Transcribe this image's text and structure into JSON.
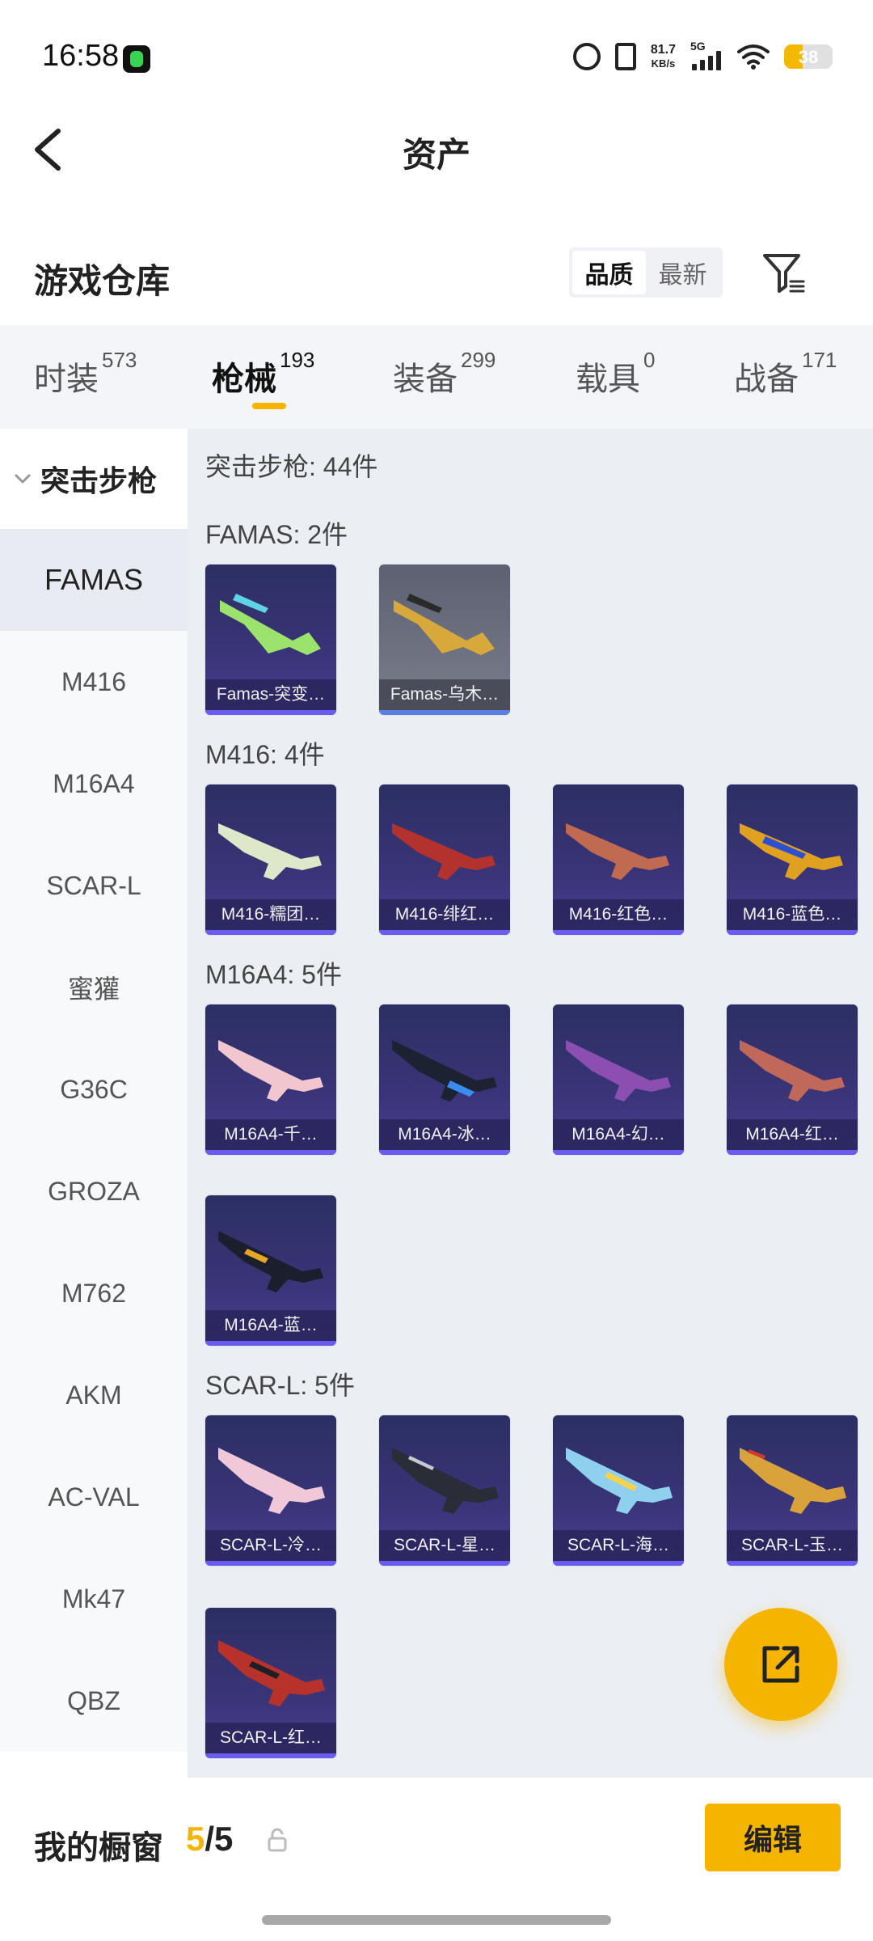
{
  "status_bar": {
    "time": "16:58",
    "speed_value": "81.7",
    "speed_unit": "KB/s",
    "network": "5G",
    "battery": "38",
    "battery_level": 0.38,
    "icons": [
      "alarm-icon",
      "vibrate-icon",
      "signal-icon",
      "wifi-icon",
      "battery-icon"
    ]
  },
  "header": {
    "title": "资产"
  },
  "warehouse": {
    "title": "游戏仓库",
    "sort_options": [
      "品质",
      "最新"
    ],
    "sort_selected": "品质"
  },
  "tabs": [
    {
      "label": "时装",
      "count": "573"
    },
    {
      "label": "枪械",
      "count": "193",
      "active": true
    },
    {
      "label": "装备",
      "count": "299"
    },
    {
      "label": "载具",
      "count": "0"
    },
    {
      "label": "战备",
      "count": "171"
    }
  ],
  "sidebar": {
    "group_label": "突击步枪",
    "items": [
      "FAMAS",
      "M416",
      "M16A4",
      "SCAR-L",
      "蜜獾",
      "G36C",
      "GROZA",
      "M762",
      "AKM",
      "AC-VAL",
      "Mk47",
      "QBZ"
    ],
    "selected": "FAMAS"
  },
  "content": {
    "summary": "突击步枪: 44件",
    "sections": [
      {
        "label": "FAMAS: 2件",
        "items": [
          "Famas-突变…",
          "Famas-乌木…"
        ]
      },
      {
        "label": "M416: 4件",
        "items": [
          "M416-糯团…",
          "M416-绯红…",
          "M416-红色…",
          "M416-蓝色…"
        ]
      },
      {
        "label": "M16A4: 5件",
        "items": [
          "M16A4-千…",
          "M16A4-冰…",
          "M16A4-幻…",
          "M16A4-红…",
          "M16A4-蓝…"
        ]
      },
      {
        "label": "SCAR-L: 5件",
        "items": [
          "SCAR-L-冷…",
          "SCAR-L-星…",
          "SCAR-L-海…",
          "SCAR-L-玉…",
          "SCAR-L-红…"
        ]
      }
    ]
  },
  "bottom_bar": {
    "showcase_label": "我的橱窗",
    "showcase_current": "5",
    "showcase_separator": "/",
    "showcase_total": "5",
    "edit_label": "编辑"
  },
  "colors": {
    "accent": "#f5b400",
    "card_purple": "#3a3478",
    "content_bg": "#ebeef3"
  }
}
